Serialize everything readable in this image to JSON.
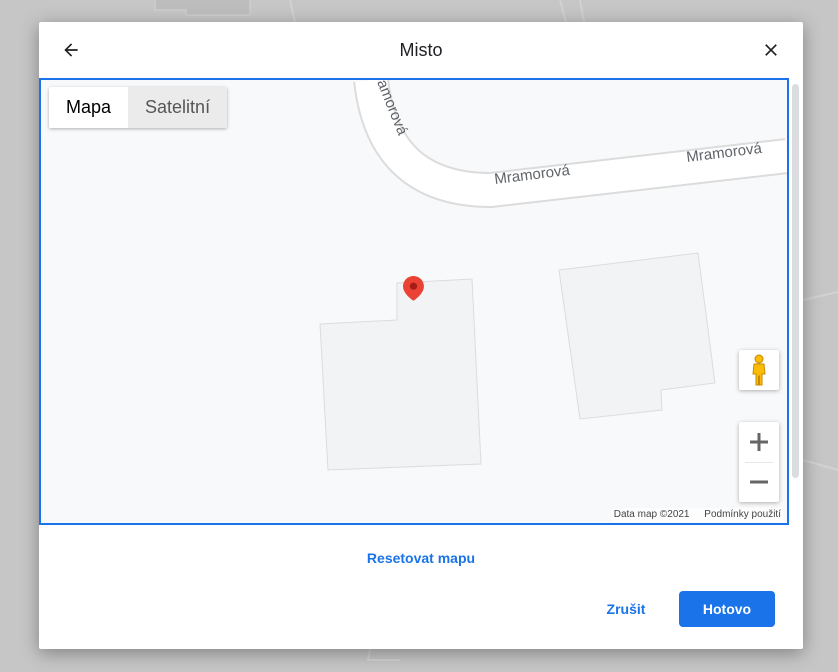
{
  "dialog": {
    "title": "Misto",
    "back_icon": "arrow-back-icon",
    "close_icon": "close-icon"
  },
  "map": {
    "type_control": {
      "map_label": "Mapa",
      "satellite_label": "Satelitní",
      "selected": "Mapa"
    },
    "street_labels": [
      "amorová",
      "Mramorová",
      "Mramorová"
    ],
    "attribution": {
      "data": "Data map ©2021",
      "terms": "Podmínky použití"
    },
    "marker_color": "#ea4335",
    "pegman_icon": "pegman-icon",
    "zoom_in_icon": "plus-icon",
    "zoom_out_icon": "minus-icon"
  },
  "footer": {
    "reset_label": "Resetovat mapu",
    "cancel_label": "Zrušit",
    "done_label": "Hotovo"
  },
  "colors": {
    "accent": "#1a73e8",
    "marker": "#ea4335"
  }
}
